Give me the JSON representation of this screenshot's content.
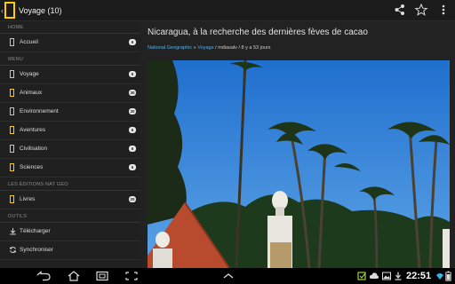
{
  "actionbar": {
    "title": "Voyage (10)",
    "icons": [
      "back-icon",
      "share-icon",
      "star-icon",
      "overflow-menu-icon"
    ]
  },
  "sidebar": {
    "sections": {
      "home": "HOME",
      "menu": "MENU",
      "editions": "LES ÉDITIONS NAT GEO",
      "tools": "OUTILS"
    },
    "home_items": [
      {
        "label": "Accueil",
        "count": "6"
      }
    ],
    "menu_items": [
      {
        "label": "Voyage",
        "count": "6"
      },
      {
        "label": "Animaux",
        "count": "30"
      },
      {
        "label": "Environnement",
        "count": "30"
      },
      {
        "label": "Aventures",
        "count": "6"
      },
      {
        "label": "Civilisation",
        "count": "6"
      },
      {
        "label": "Sciences",
        "count": "6"
      }
    ],
    "edition_items": [
      {
        "label": "Livres",
        "count": "20"
      }
    ],
    "tool_items": [
      {
        "label": "Télécharger",
        "icon": "download-icon"
      },
      {
        "label": "Synchroniser",
        "icon": "sync-icon"
      }
    ]
  },
  "article": {
    "title": "Nicaragua, à la recherche des dernières fèves de cacao",
    "source": "National Geographic",
    "separator": " » ",
    "category": "Voyage",
    "author_age": " / mdiasalv / 8 y a 53 jours",
    "image_alt": "palm-trees-photo"
  },
  "systembar": {
    "time": "22:51",
    "icons": [
      "back-nav-icon",
      "home-nav-icon",
      "recent-apps-icon",
      "screenshot-icon",
      "up-chevron-icon",
      "notification-icon",
      "cloud-icon",
      "image-icon",
      "download-notif-icon",
      "wifi-icon",
      "battery-icon"
    ]
  },
  "colors": {
    "brand_yellow": "#ffcc00",
    "link_blue": "#4fb0e8",
    "sky": "#2f7fd6"
  }
}
